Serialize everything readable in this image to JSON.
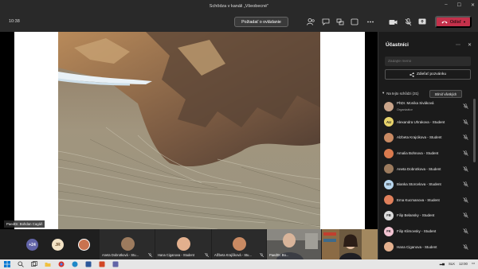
{
  "window": {
    "title": "Schôdza v kanáli „Všeobecné\""
  },
  "toolbar": {
    "timer": "10:38",
    "raise_hand": "Požiadať o ovládanie",
    "leave": "Odísť"
  },
  "stage": {
    "presenter": "PaedDr. Bohdan Cagáň"
  },
  "strip": {
    "overflow_count": "+24",
    "initials_avatar": "JR",
    "thumbnails": [
      {
        "name": "Aneta Dobrotková - Stu..."
      },
      {
        "name": "Hana Ciganova - Student"
      },
      {
        "name": "Alžbeta Krajčiková - Stu..."
      },
      {
        "name": "PaedDr. Bo..."
      }
    ]
  },
  "panel": {
    "title": "Účastníci",
    "invite_placeholder": "Zadajte meno",
    "share_invite": "Zdieľať pozvánku",
    "section_label": "Na tejto schôdzi (31)",
    "mute_all": "Stlmiť všetkých",
    "participants": [
      {
        "name": "PhDr. Monika Siváková",
        "sub": "Organizátor",
        "initials": "",
        "color": "#c9a48a"
      },
      {
        "name": "Alexandra Uhrakova - Student",
        "sub": "",
        "initials": "AU",
        "color": "#e8d36b"
      },
      {
        "name": "Alzbeta Krajcikova - Student",
        "sub": "",
        "initials": "",
        "color": "#c98a63"
      },
      {
        "name": "Amalia Bohnova - Student",
        "sub": "",
        "initials": "",
        "color": "#d97a4e"
      },
      {
        "name": "Aneta Dobrotkova - Student",
        "sub": "",
        "initials": "",
        "color": "#9c7b5e"
      },
      {
        "name": "Bianka Storcelova - Student",
        "sub": "",
        "initials": "BS",
        "color": "#b9d7ee"
      },
      {
        "name": "Ema Kucmanova - Student",
        "sub": "",
        "initials": "",
        "color": "#e0805b"
      },
      {
        "name": "Filip Belansky - Student",
        "sub": "",
        "initials": "FB",
        "color": "#dcdcdc"
      },
      {
        "name": "Filip Klimovsky - Student",
        "sub": "",
        "initials": "FK",
        "color": "#f2c4d2"
      },
      {
        "name": "Hana Ciganova - Student",
        "sub": "",
        "initials": "",
        "color": "#e3b08e"
      }
    ]
  },
  "taskbar": {
    "lang": "SLK",
    "time": "12:00"
  },
  "colors": {
    "leave": "#c4314b",
    "accent": "#6264a7"
  }
}
